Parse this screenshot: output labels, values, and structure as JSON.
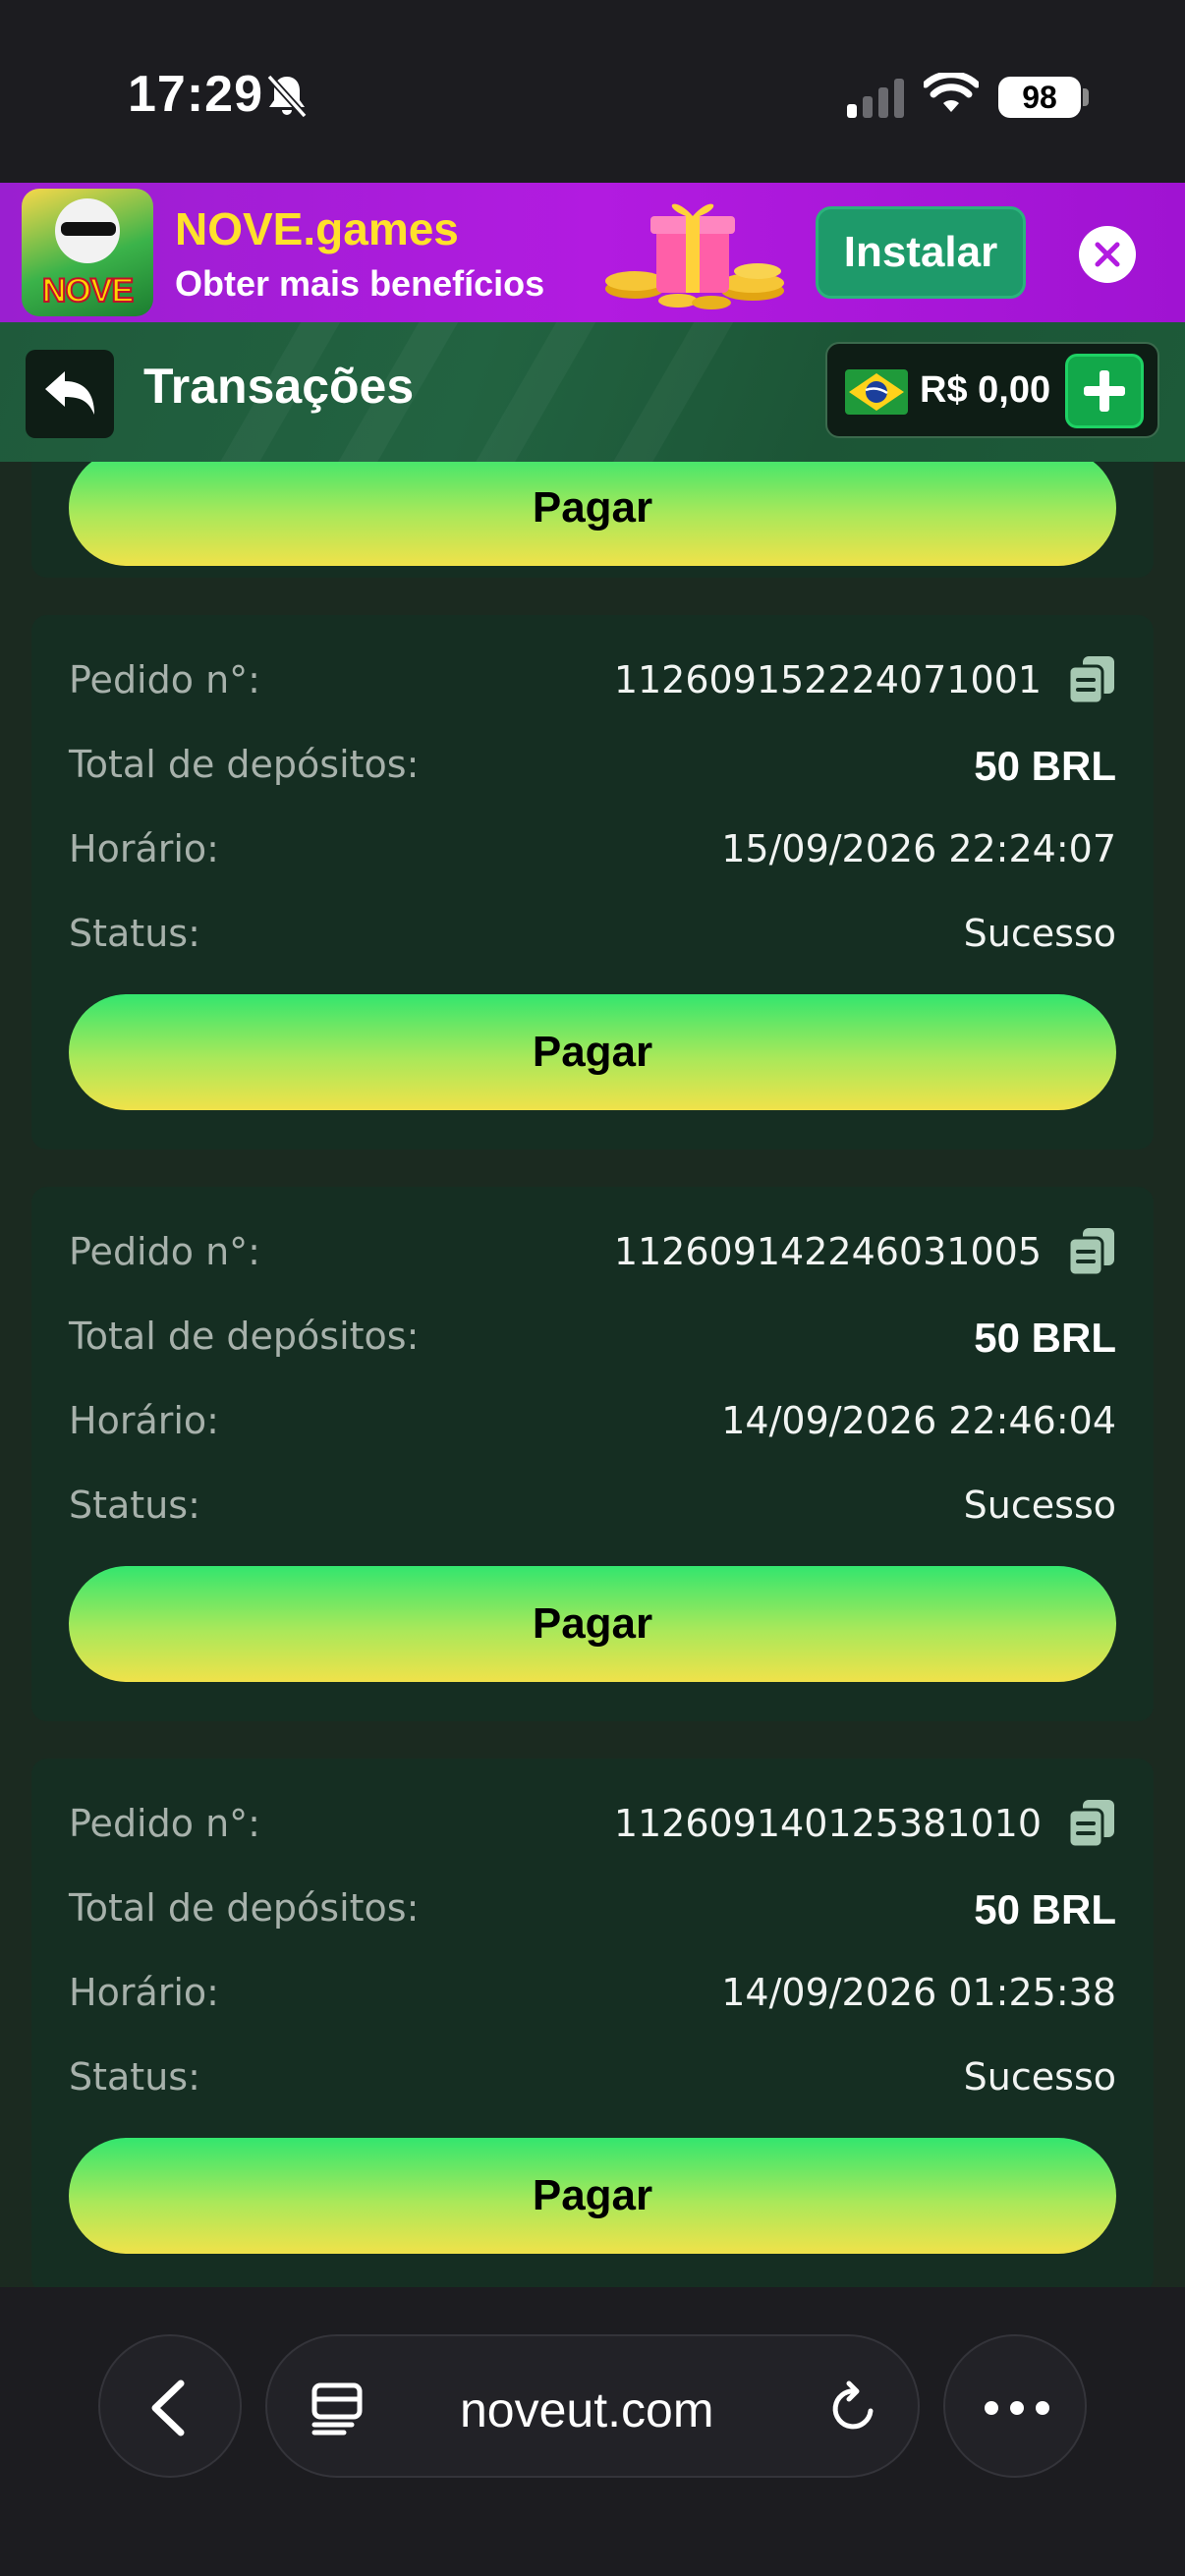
{
  "status_bar": {
    "time": "17:29",
    "battery": "98",
    "icons": [
      "bell-muted-icon",
      "signal-icon",
      "wifi-icon",
      "battery-icon"
    ]
  },
  "promo": {
    "logo_text": "NOVE",
    "title": "NOVE.games",
    "subtitle": "Obter mais benefícios",
    "install_label": "Instalar",
    "colors": {
      "background": "#a813d6",
      "title": "#ffe12b",
      "install": "#1e9a6a"
    }
  },
  "header": {
    "title": "Transações",
    "balance": "R$ 0,00",
    "icons": [
      "back-arrow-icon",
      "brazil-flag-icon",
      "plus-icon"
    ]
  },
  "labels": {
    "order": "Pedido n°:",
    "total": "Total de depósitos:",
    "time": "Horário:",
    "status": "Status:"
  },
  "transactions": [
    {
      "order": "",
      "total": "",
      "time": "",
      "status": "",
      "pay_label": "Pagar"
    },
    {
      "order": "112609152224071001",
      "total": "50 BRL",
      "time": "15/09/2026 22:24:07",
      "status": "Sucesso",
      "pay_label": "Pagar"
    },
    {
      "order": "112609142246031005",
      "total": "50 BRL",
      "time": "14/09/2026 22:46:04",
      "status": "Sucesso",
      "pay_label": "Pagar"
    },
    {
      "order": "112609140125381010",
      "total": "50 BRL",
      "time": "14/09/2026 01:25:38",
      "status": "Sucesso",
      "pay_label": "Pagar"
    }
  ],
  "browser": {
    "url": "noveut.com",
    "icons": [
      "chevron-left-icon",
      "tabs-icon",
      "reload-icon",
      "more-icon"
    ]
  }
}
